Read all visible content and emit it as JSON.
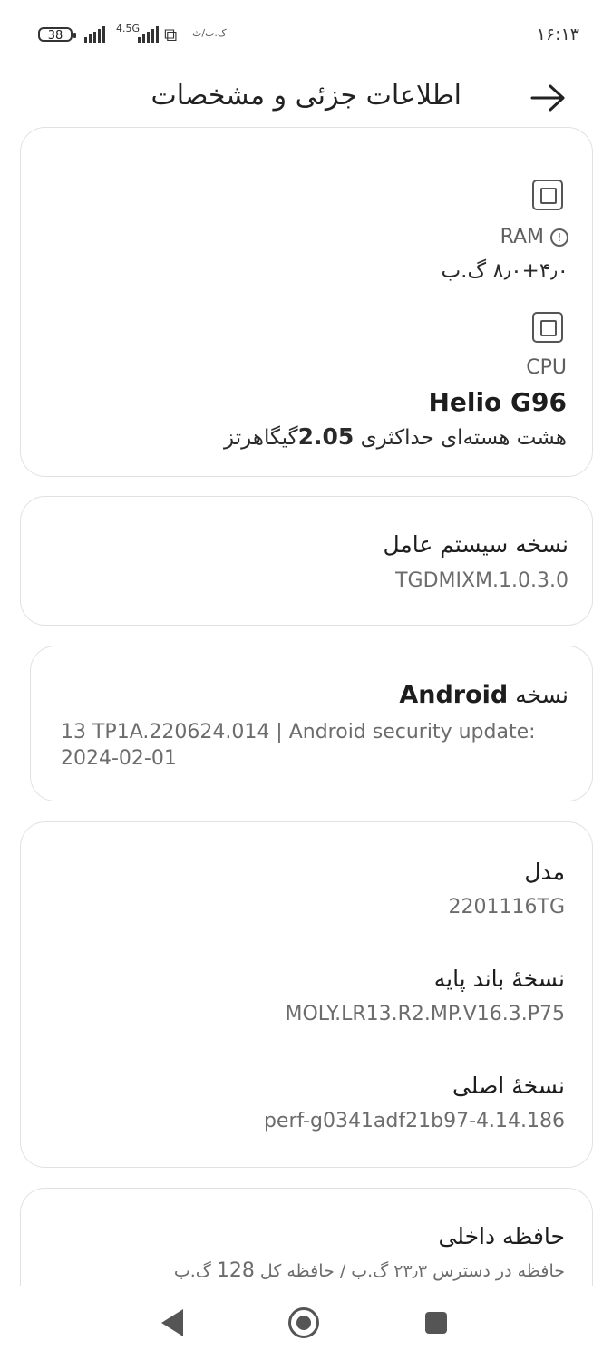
{
  "status_bar": {
    "time": "۱۶:۱۳",
    "battery": "38",
    "network": "4.5G",
    "carrier": "ک.ب/ث"
  },
  "header": {
    "title": "اطلاعات جزئی و مشخصات",
    "back_icon": "arrow-right-icon"
  },
  "specs": {
    "ram_label": "RAM",
    "ram_value": "۸٫۰+۴٫۰ گ.ب",
    "cpu_label": "CPU",
    "cpu_name": "Helio G96",
    "cpu_desc_prefix": "هشت هسته‌ای حداکثری",
    "cpu_freq": "2.05",
    "cpu_desc_suffix": "گیگاهرتز"
  },
  "os": {
    "label": "نسخه سیستم عامل",
    "value": "1.0.3.0.TGDMIXM"
  },
  "android": {
    "label_prefix": "نسخه",
    "label_brand": "Android",
    "line1": "13 TP1A.220624.014 | Android security update:",
    "line2": "2024-02-01"
  },
  "device": {
    "model_label": "مدل",
    "model_value": "2201116TG",
    "baseband_label": "نسخهٔ باند پایه",
    "baseband_value": "MOLY.LR13.R2.MP.V16.3.P75",
    "kernel_label": "نسخهٔ اصلی",
    "kernel_value": "4.14.186-perf-g0341adf21b97"
  },
  "storage": {
    "label": "حافظه داخلی",
    "avail_text": "حافظه در دسترس",
    "avail_value": "۲۳٫۳ گ.ب",
    "sep": "/",
    "total_text": "حافظه کل",
    "total_value": "128",
    "total_unit": "گ.ب"
  }
}
